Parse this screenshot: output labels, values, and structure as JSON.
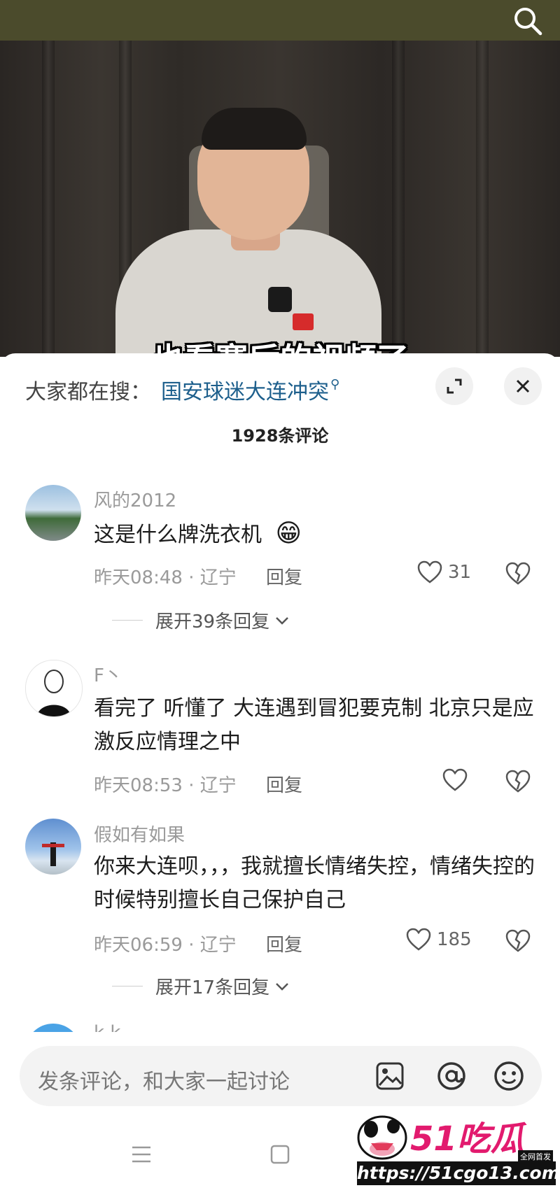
{
  "video": {
    "subtitle": "也看赛后的视频了"
  },
  "sheet": {
    "trending_label": "大家都在搜：",
    "trending_term": "国安球迷大连冲突",
    "comment_count": "1928条评论"
  },
  "comments": [
    {
      "username": "风的2012",
      "text": "这是什么牌洗衣机",
      "emoji": "😁",
      "meta": "昨天08:48 · 辽宁",
      "reply": "回复",
      "likes": "31",
      "expand": "展开39条回复"
    },
    {
      "username": "F丶",
      "text": "看完了 听懂了 大连遇到冒犯要克制 北京只是应激反应情理之中",
      "meta": "昨天08:53 · 辽宁",
      "reply": "回复",
      "likes": ""
    },
    {
      "username": "假如有如果",
      "text": "你来大连呗，，，我就擅长情绪失控，情绪失控的时候特别擅长自己保护自己",
      "meta": "昨天06:59 · 辽宁",
      "reply": "回复",
      "likes": "185",
      "expand": "展开17条回复"
    },
    {
      "username": "k k"
    }
  ],
  "input": {
    "placeholder": "发条评论，和大家一起讨论"
  },
  "watermark": {
    "brand": "51吃瓜",
    "tag": "全网首发",
    "url": "https://51cgo13.com"
  },
  "colors": {
    "topbar": "#4b4b2c",
    "trending_term": "#1d5f8c",
    "watermark_brand": "#e21a6e"
  }
}
